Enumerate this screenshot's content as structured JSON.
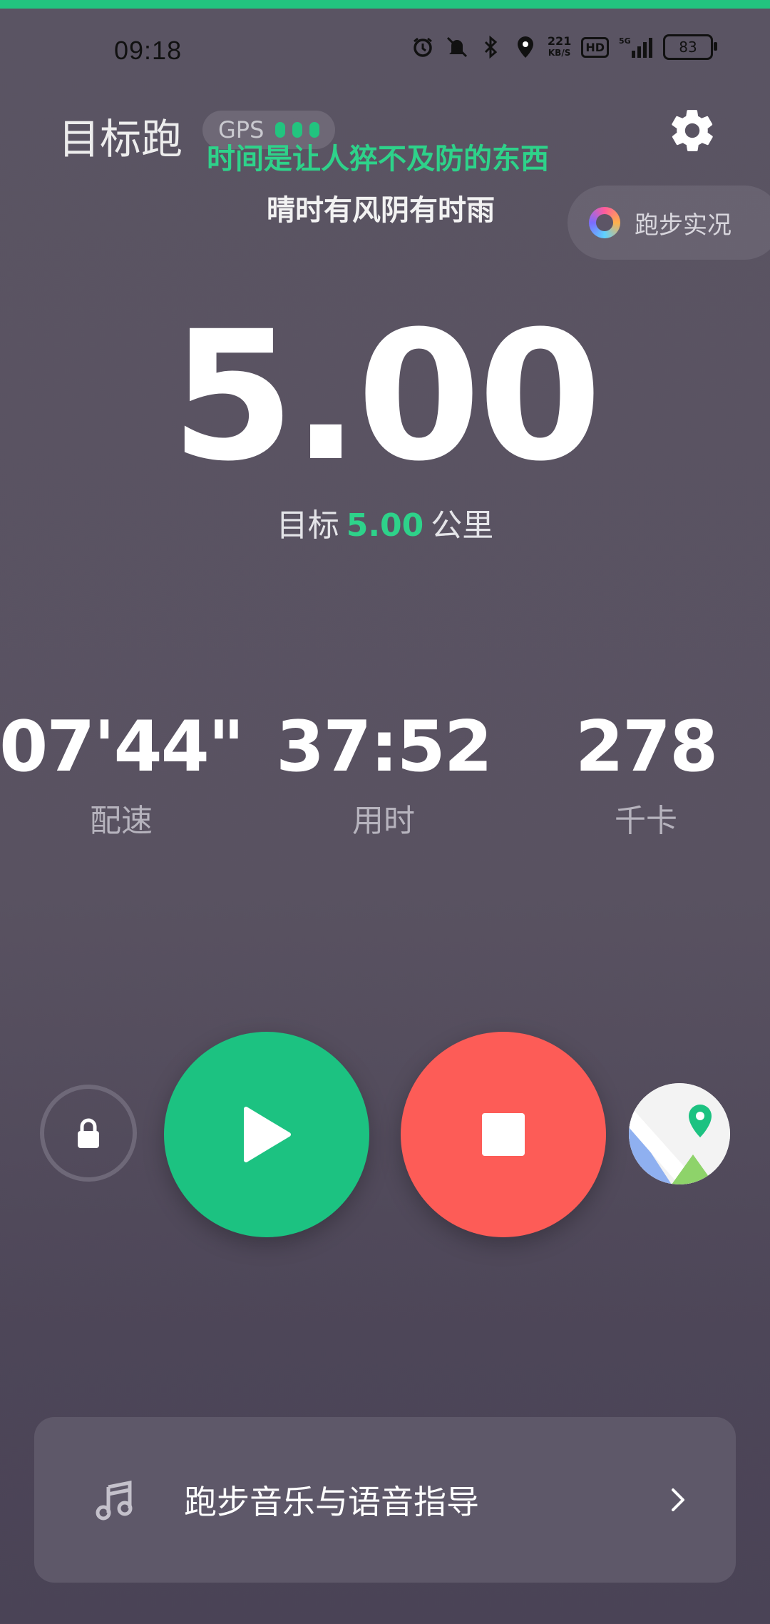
{
  "status_bar": {
    "time": "09:18",
    "net_speed_value": "221",
    "net_speed_unit": "KB/S",
    "hd": "HD",
    "network": "5G",
    "battery": "83",
    "icons": [
      "alarm-icon",
      "mute-icon",
      "bluetooth-icon",
      "location-icon",
      "signal-icon",
      "battery-icon"
    ]
  },
  "header": {
    "title": "目标跑",
    "gps_label": "GPS",
    "lyric_line1": "时间是让人猝不及防的东西",
    "lyric_line2": "晴时有风阴有时雨",
    "settings_icon": "gear-icon"
  },
  "live_status": {
    "label": "跑步实况"
  },
  "distance": {
    "value": "5.00",
    "target_prefix": "目标",
    "target_value": "5.00",
    "target_unit": "公里"
  },
  "stats": [
    {
      "value": "07'44\"",
      "label": "配速"
    },
    {
      "value": "37:52",
      "label": "用时"
    },
    {
      "value": "278",
      "label": "千卡"
    }
  ],
  "controls": {
    "lock_icon": "lock-icon",
    "play_icon": "play-icon",
    "stop_icon": "stop-icon",
    "map_icon": "map-icon"
  },
  "music_bar": {
    "label": "跑步音乐与语音指导"
  },
  "colors": {
    "accent_green": "#1cc281",
    "stop_red": "#fd5c57",
    "background": "#595261"
  }
}
